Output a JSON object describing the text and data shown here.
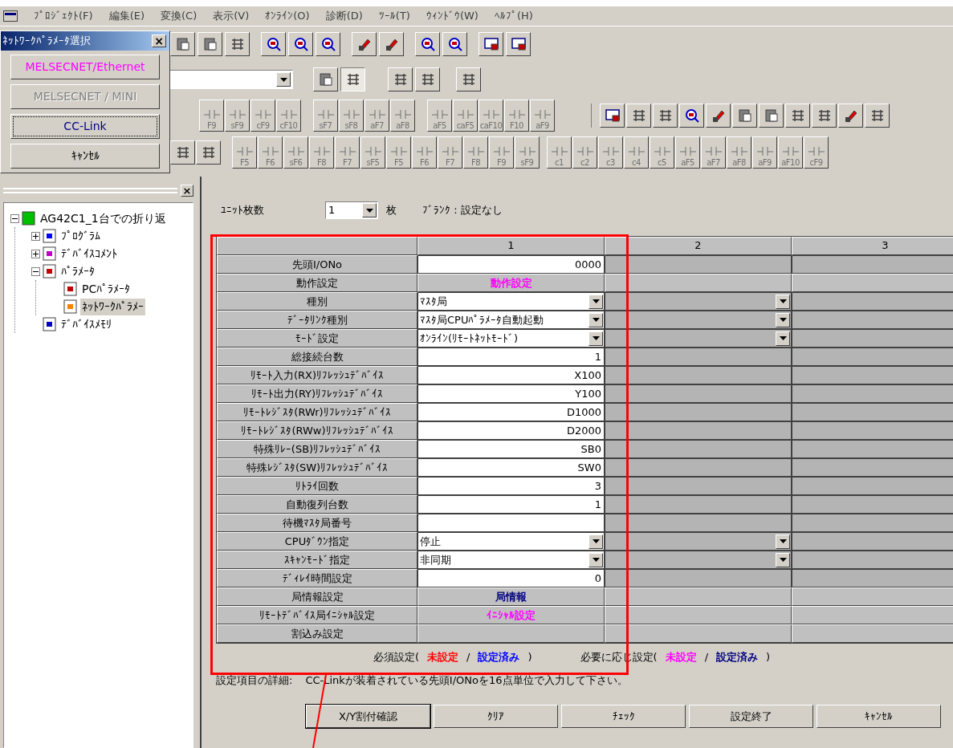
{
  "menu": [
    "ﾌﾟﾛｼﾞｪｸﾄ(F)",
    "編集(E)",
    "変換(C)",
    "表示(V)",
    "ｵﾝﾗｲﾝ(O)",
    "診断(D)",
    "ﾂｰﾙ(T)",
    "ｳｨﾝﾄﾞｳ(W)",
    "ﾍﾙﾌﾟ(H)"
  ],
  "dialog": {
    "title": "ﾈｯﾄﾜｰｸﾊﾟﾗﾒｰﾀ選択",
    "close": "×",
    "buttons": [
      {
        "label": "MELSECNET/Ethernet",
        "color": "#ff00ff",
        "disabled": false,
        "focused": false
      },
      {
        "label": "MELSECNET / MINI",
        "color": "#808080",
        "disabled": true,
        "focused": false
      },
      {
        "label": "CC-Link",
        "color": "#000080",
        "disabled": false,
        "focused": true
      },
      {
        "label": "ｷｬﾝｾﾙ",
        "color": "#000000",
        "disabled": false,
        "focused": false
      }
    ]
  },
  "toolbar": {
    "row3_groups": [
      [
        "F9",
        "sF9",
        "cF9",
        "cF10"
      ],
      [
        "sF7",
        "sF8",
        "aF7",
        "aF8"
      ],
      [
        "aF5",
        "caF5",
        "caF10",
        "F10",
        "aF9"
      ]
    ],
    "row4_groups": [
      [
        "F5",
        "F6",
        "sF6",
        "F8",
        "F7",
        "sF5",
        "F5",
        "F6",
        "F7",
        "F8",
        "F9",
        "sF9"
      ],
      [
        "c1",
        "c2",
        "c3",
        "c4",
        "c5",
        "aF5",
        "aF7",
        "aF8",
        "aF9",
        "aF10",
        "cF9"
      ]
    ]
  },
  "tree": {
    "close": "×",
    "items": [
      {
        "label": "AG42C1_1台での折り返",
        "kind": "project",
        "expanded": true,
        "selected": false,
        "children": [
          {
            "label": "ﾌﾟﾛｸﾞﾗﾑ",
            "kind": "program",
            "expanded": false,
            "selected": false
          },
          {
            "label": "ﾃﾞﾊﾞｲｽｺﾒﾝﾄ",
            "kind": "comment",
            "expanded": false,
            "selected": false
          },
          {
            "label": "ﾊﾟﾗﾒｰﾀ",
            "kind": "parameter",
            "expanded": true,
            "selected": false,
            "children": [
              {
                "label": "PCﾊﾟﾗﾒｰﾀ",
                "kind": "parameter",
                "selected": false
              },
              {
                "label": "ﾈｯﾄﾜｰｸﾊﾟﾗﾒｰ",
                "kind": "network",
                "selected": true
              }
            ]
          },
          {
            "label": "ﾃﾞﾊﾞｲｽﾒﾓﾘ",
            "kind": "memory",
            "selected": false
          }
        ]
      }
    ]
  },
  "unit": {
    "label": "ﾕﾆｯﾄ枚数",
    "value": "1",
    "suffix": "枚",
    "note": "ﾌﾞﾗﾝｸ : 設定なし"
  },
  "table": {
    "columns": [
      "1",
      "2",
      "3"
    ],
    "rows": [
      {
        "label": "先頭I/ONo",
        "kind": "value",
        "value": "0000"
      },
      {
        "label": "動作設定",
        "kind": "button",
        "value": "動作設定",
        "color": "#ff00ff"
      },
      {
        "label": "種別",
        "kind": "select",
        "value": "ﾏｽﾀ局"
      },
      {
        "label": "ﾃﾞｰﾀﾘﾝｸ種別",
        "kind": "select",
        "value": "ﾏｽﾀ局CPUﾊﾟﾗﾒｰﾀ自動起動"
      },
      {
        "label": "ﾓｰﾄﾞ設定",
        "kind": "select",
        "value": "ｵﾝﾗｲﾝ(ﾘﾓｰﾄﾈｯﾄﾓｰﾄﾞ)"
      },
      {
        "label": "総接続台数",
        "kind": "value",
        "value": "1"
      },
      {
        "label": "ﾘﾓｰﾄ入力(RX)ﾘﾌﾚｯｼｭﾃﾞﾊﾞｲｽ",
        "kind": "value",
        "value": "X100"
      },
      {
        "label": "ﾘﾓｰﾄ出力(RY)ﾘﾌﾚｯｼｭﾃﾞﾊﾞｲｽ",
        "kind": "value",
        "value": "Y100"
      },
      {
        "label": "ﾘﾓｰﾄﾚｼﾞｽﾀ(RWr)ﾘﾌﾚｯｼｭﾃﾞﾊﾞｲｽ",
        "kind": "value",
        "value": "D1000"
      },
      {
        "label": "ﾘﾓｰﾄﾚｼﾞｽﾀ(RWw)ﾘﾌﾚｯｼｭﾃﾞﾊﾞｲｽ",
        "kind": "value",
        "value": "D2000"
      },
      {
        "label": "特殊ﾘﾚｰ(SB)ﾘﾌﾚｯｼｭﾃﾞﾊﾞｲｽ",
        "kind": "value",
        "value": "SB0"
      },
      {
        "label": "特殊ﾚｼﾞｽﾀ(SW)ﾘﾌﾚｯｼｭﾃﾞﾊﾞｲｽ",
        "kind": "value",
        "value": "SW0"
      },
      {
        "label": "ﾘﾄﾗｲ回数",
        "kind": "value",
        "value": "3"
      },
      {
        "label": "自動復列台数",
        "kind": "value",
        "value": "1"
      },
      {
        "label": "待機ﾏｽﾀ局番号",
        "kind": "value"
      },
      {
        "label": "CPUﾀﾞｳﾝ指定",
        "kind": "select",
        "value": "停止"
      },
      {
        "label": "ｽｷｬﾝﾓｰﾄﾞ指定",
        "kind": "select",
        "value": "非同期"
      },
      {
        "label": "ﾃﾞｨﾚｲ時間設定",
        "kind": "value",
        "value": "0"
      },
      {
        "label": "局情報設定",
        "kind": "button",
        "value": "局情報",
        "color": "#000080"
      },
      {
        "label": "ﾘﾓｰﾄﾃﾞﾊﾞｲｽ局ｲﾆｼｬﾙ設定",
        "kind": "button",
        "value": "ｲﾆｼｬﾙ設定",
        "color": "#ff00ff"
      },
      {
        "label": "割込み設定",
        "kind": "button"
      }
    ]
  },
  "legend": [
    {
      "label": "必須設定(",
      "close": ")",
      "separator": "/",
      "items": [
        {
          "label": "未設定",
          "color": "#ff0000"
        },
        {
          "label": "設定済み",
          "color": "#0000ff"
        }
      ]
    },
    {
      "label": "必要に応じ設定(",
      "close": ")",
      "separator": "/",
      "items": [
        {
          "label": "未設定",
          "color": "#ff00ff"
        },
        {
          "label": "設定済み",
          "color": "#000080"
        }
      ]
    }
  ],
  "detail": {
    "label": "設定項目の詳細:",
    "text": "CC-Linkが装着されている先頭I/ONoを16点単位で入力して下さい。"
  },
  "buttons": [
    {
      "label": "X/Y割付確認",
      "default": true
    },
    {
      "label": "ｸﾘｱ",
      "default": false
    },
    {
      "label": "ﾁｪｯｸ",
      "default": false
    },
    {
      "label": "設定終了",
      "default": false
    },
    {
      "label": "ｷｬﾝｾﾙ",
      "default": false
    }
  ]
}
